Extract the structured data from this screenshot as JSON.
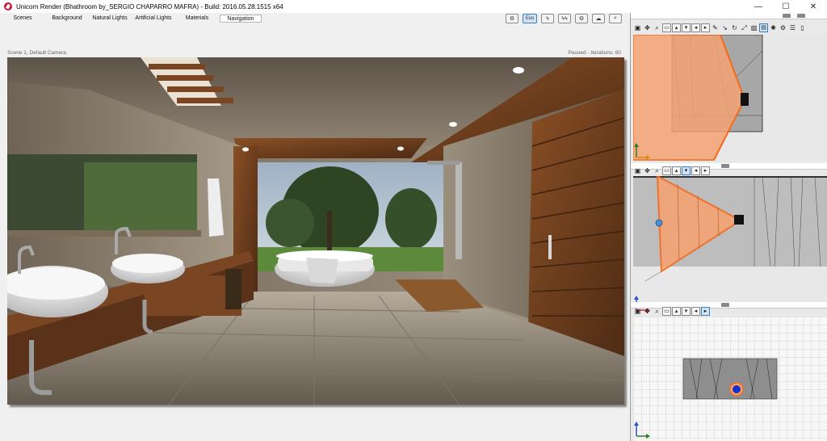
{
  "window": {
    "title": "Unicorn Render (Bhathroom by_SERGIO CHAPARRO MAFRA) - Build: 2016.05.28.1515 x64",
    "minimize": "—",
    "maximize": "☐",
    "close": "✕"
  },
  "tabs": [
    {
      "label": "Scenes"
    },
    {
      "label": "Background"
    },
    {
      "label": "Natural Lights"
    },
    {
      "label": "Artificial Lights"
    },
    {
      "label": "Materials"
    },
    {
      "label": "Navigation"
    }
  ],
  "toolbar": {
    "evo_label": "Evo"
  },
  "scene": {
    "camera_label": "Scene 1, Default Camera",
    "render_status": "Paused - Iterations: 60"
  },
  "colors": {
    "frustum_fill": "#f4a373",
    "frustum_stroke": "#f26c21",
    "accent_blue": "#3c7fc1"
  },
  "icons": {
    "window_icon": "unicorn-logo-icon",
    "view_tools": [
      "camera-view-icon",
      "move-icon",
      "zoom-icon",
      "view-front-icon",
      "view-top-icon",
      "view-bottom-icon",
      "view-left-icon",
      "view-right-icon"
    ]
  }
}
